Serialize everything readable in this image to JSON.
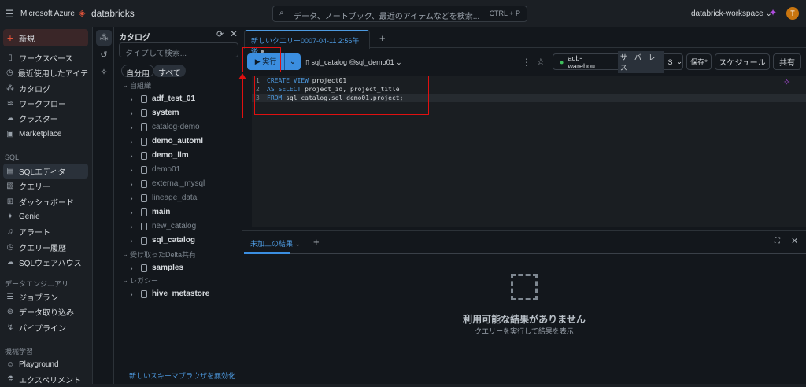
{
  "topbar": {
    "brand1": "Microsoft Azure",
    "brand2": "databricks",
    "search_placeholder": "データ、ノートブック、最近のアイテムなどを検索...",
    "shortcut": "CTRL + P",
    "workspace": "databrick-workspace",
    "avatar": "T"
  },
  "sidebar": {
    "new": "新規",
    "items": [
      "ワークスペース",
      "最近使用したアイテ...",
      "カタログ",
      "ワークフロー",
      "クラスター",
      "Marketplace"
    ],
    "sql_label": "SQL",
    "sql_items": [
      "SQLエディタ",
      "クエリー",
      "ダッシュボード",
      "Genie",
      "アラート",
      "クエリー履歴",
      "SQLウェアハウス"
    ],
    "de_label": "データエンジニアリ...",
    "de_items": [
      "ジョブラン",
      "データ取り込み",
      "パイプライン"
    ],
    "ml_label": "機械学習",
    "ml_items": [
      "Playground",
      "エクスペリメント"
    ]
  },
  "catalog": {
    "title": "カタログ",
    "search_placeholder": "タイプして検索...",
    "chip_mine": "自分用",
    "chip_all": "すべて",
    "group_org": "自組織",
    "org_items": [
      {
        "name": "adf_test_01",
        "bold": true
      },
      {
        "name": "system",
        "bold": true
      },
      {
        "name": "catalog-demo",
        "bold": false
      },
      {
        "name": "demo_automl",
        "bold": true
      },
      {
        "name": "demo_llm",
        "bold": true
      },
      {
        "name": "demo01",
        "bold": false
      },
      {
        "name": "external_mysql",
        "bold": false
      },
      {
        "name": "lineage_data",
        "bold": false
      },
      {
        "name": "main",
        "bold": true
      },
      {
        "name": "new_catalog",
        "bold": false
      },
      {
        "name": "sql_catalog",
        "bold": true
      }
    ],
    "group_delta": "受け取ったDelta共有",
    "delta_items": [
      "samples"
    ],
    "group_legacy": "レガシー",
    "legacy_items": [
      "hive_metastore"
    ],
    "footer_link": "新しいスキーマブラウザを無効化"
  },
  "editor": {
    "tab": "新しいクエリー0007-04-11 2:56午後",
    "run": "▶ 実行",
    "catalog": "sql_catalog",
    "schema": "sql_demo01",
    "warehouse": "adb-warehou...",
    "serverless": "サーバーレス",
    "size": "S",
    "save": "保存*",
    "schedule": "スケジュール",
    "share": "共有",
    "lines": [
      [
        "CREATE VIEW",
        " project01"
      ],
      [
        "AS SELECT",
        " project_id, project_title"
      ],
      [
        "FROM",
        " sql_catalog.sql_demo01.project;"
      ]
    ]
  },
  "results": {
    "tab": "未加工の結果",
    "empty_title": "利用可能な結果がありません",
    "empty_sub": "クエリーを実行して結果を表示"
  }
}
